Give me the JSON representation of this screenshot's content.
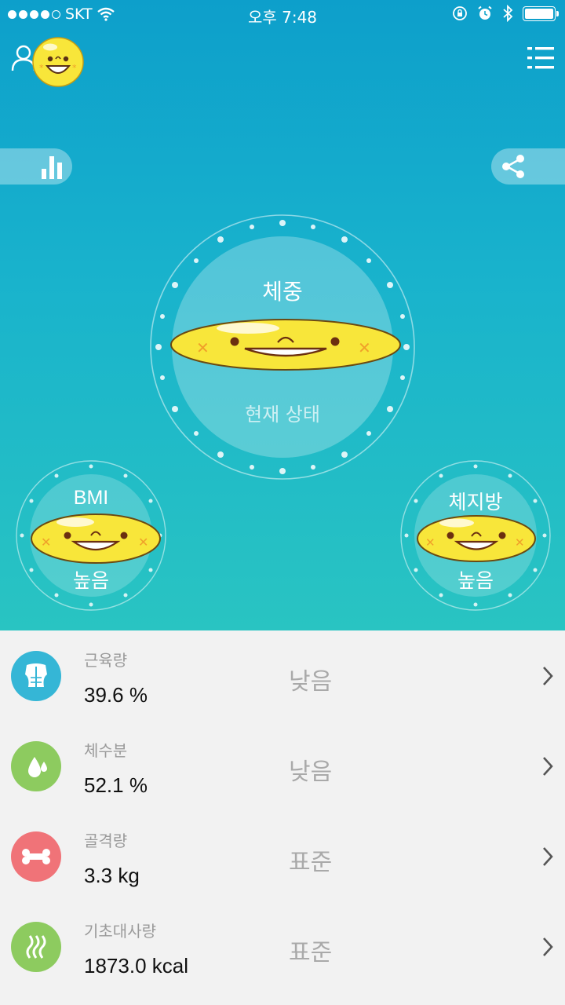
{
  "status_bar": {
    "carrier": "SKT",
    "time": "오후 7:48"
  },
  "main": {
    "weight": {
      "title": "체중",
      "state": "현재 상태"
    },
    "bmi": {
      "title": "BMI",
      "state": "높음"
    },
    "body_fat": {
      "title": "체지방",
      "state": "높음"
    }
  },
  "metrics": [
    {
      "label": "근육량",
      "value": "39.6 %",
      "status": "낮음",
      "color": "#35b6d6",
      "icon": "muscle-icon"
    },
    {
      "label": "체수분",
      "value": "52.1 %",
      "status": "낮음",
      "color": "#8dcb5f",
      "icon": "water-drop-icon"
    },
    {
      "label": "골격량",
      "value": "3.3 kg",
      "status": "표준",
      "color": "#f07378",
      "icon": "bone-icon"
    },
    {
      "label": "기초대사량",
      "value": "1873.0 kcal",
      "status": "표준",
      "color": "#8dcb5f",
      "icon": "heat-waves-icon"
    }
  ],
  "colors": {
    "hero_top": "#0d9fcb",
    "hero_bottom": "#29c4c2",
    "emoji_yellow": "#f8e63a"
  }
}
